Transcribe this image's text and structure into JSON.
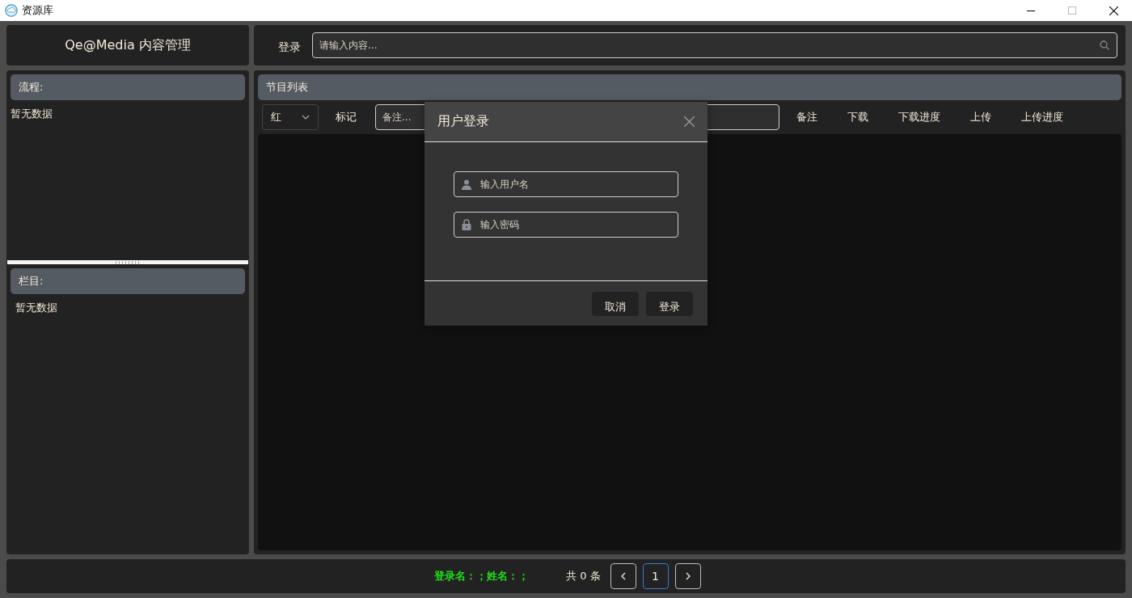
{
  "window": {
    "title": "资源库"
  },
  "header": {
    "brand": "Qe@Media 内容管理",
    "login_link": "登录",
    "search": {
      "placeholder": "请输入内容..."
    }
  },
  "sidebar": {
    "sections": [
      {
        "title": "流程:",
        "empty_text": "暂无数据"
      },
      {
        "title": "栏目:",
        "empty_text": "暂无数据"
      }
    ]
  },
  "program_list": {
    "title": "节目列表",
    "color_select": {
      "value": "红"
    },
    "mark_label": "标记",
    "remark_field": {
      "placeholder": "备注..."
    },
    "columns": [
      "备注",
      "下载",
      "下载进度",
      "上传",
      "上传进度"
    ]
  },
  "status_bar": {
    "user_info": "登录名：；姓名：；",
    "total": "共 0 条",
    "pages": [
      {
        "label": "1",
        "selected": true
      }
    ]
  },
  "dialog": {
    "title": "用户登录",
    "fields": [
      {
        "kind": "user",
        "placeholder": "输入用户名"
      },
      {
        "kind": "password",
        "placeholder": "输入密码"
      }
    ],
    "buttons": [
      "取消",
      "登录"
    ]
  }
}
